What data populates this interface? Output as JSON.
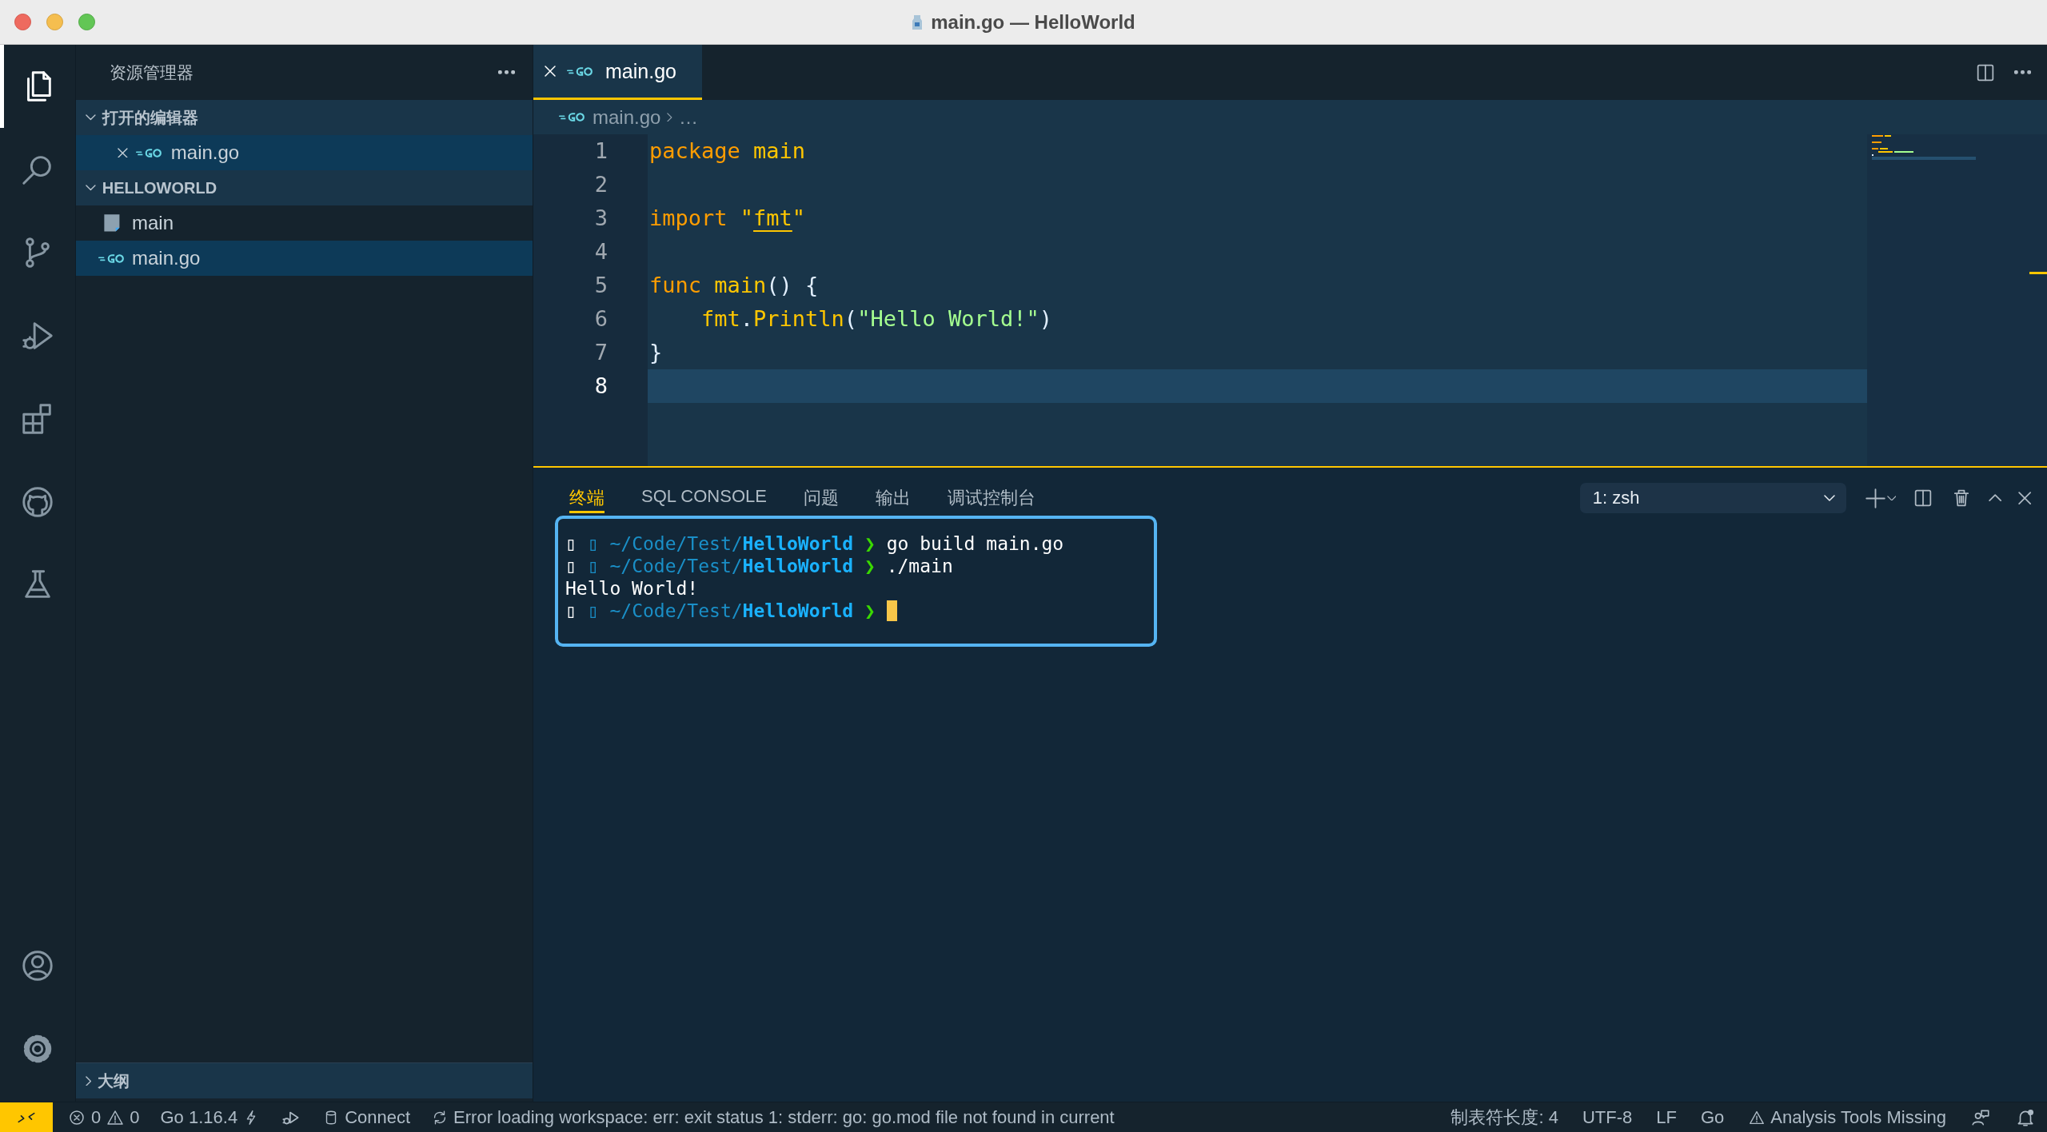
{
  "window": {
    "title": "main.go — HelloWorld"
  },
  "activity_bar": {
    "items": [
      {
        "kind": "files",
        "selected": true
      },
      {
        "kind": "search",
        "selected": false
      },
      {
        "kind": "source-control",
        "selected": false
      },
      {
        "kind": "run-debug",
        "selected": false
      },
      {
        "kind": "extensions",
        "selected": false
      },
      {
        "kind": "github",
        "selected": false
      },
      {
        "kind": "flask",
        "selected": false
      }
    ],
    "bottom": [
      {
        "kind": "account"
      },
      {
        "kind": "settings"
      }
    ]
  },
  "sidebar": {
    "title": "资源管理器",
    "sections": [
      {
        "kind": "open-editors",
        "label": "打开的编辑器",
        "expanded": true,
        "items": [
          {
            "name": "main.go",
            "kind": "go",
            "selected": true
          }
        ]
      },
      {
        "kind": "folder",
        "label": "HELLOWORLD",
        "expanded": true,
        "items": [
          {
            "name": "main",
            "kind": "file",
            "selected": false
          },
          {
            "name": "main.go",
            "kind": "go",
            "selected": true
          }
        ]
      }
    ],
    "outline": {
      "label": "大纲",
      "expanded": false
    }
  },
  "editor": {
    "tabs": [
      {
        "label": "main.go",
        "kind": "go",
        "selected": true
      }
    ],
    "breadcrumb": {
      "file": "main.go",
      "more": "…"
    },
    "lines": [
      {
        "number": "1",
        "current": false,
        "tokens": [
          {
            "kind": "keyword",
            "text": "package "
          },
          {
            "kind": "name",
            "text": "main"
          }
        ]
      },
      {
        "number": "2",
        "current": false
      },
      {
        "number": "3",
        "current": false,
        "tokens": [
          {
            "kind": "keyword",
            "text": "import "
          },
          {
            "kind": "quote",
            "text": "\""
          },
          {
            "kind": "module",
            "text": "fmt"
          },
          {
            "kind": "quote",
            "text": "\""
          }
        ]
      },
      {
        "number": "4",
        "current": false
      },
      {
        "number": "5",
        "current": false,
        "tokens": [
          {
            "kind": "keyword",
            "text": "func "
          },
          {
            "kind": "name",
            "text": "main"
          },
          {
            "kind": "plain",
            "text": "() {"
          }
        ]
      },
      {
        "number": "6",
        "current": false,
        "tokens": [
          {
            "kind": "name",
            "text": "    fmt"
          },
          {
            "kind": "plain",
            "text": "."
          },
          {
            "kind": "name",
            "text": "Println"
          },
          {
            "kind": "plain",
            "text": "("
          },
          {
            "kind": "string",
            "text": "\"Hello World!\""
          },
          {
            "kind": "plain",
            "text": ")"
          }
        ]
      },
      {
        "number": "7",
        "current": false,
        "tokens": [
          {
            "kind": "plain",
            "text": "}"
          }
        ]
      },
      {
        "number": "8",
        "current": true
      }
    ]
  },
  "panel": {
    "tabs": [
      {
        "label": "终端",
        "selected": true
      },
      {
        "label": "SQL CONSOLE",
        "selected": false
      },
      {
        "label": "问题",
        "selected": false
      },
      {
        "label": "输出",
        "selected": false
      },
      {
        "label": "调试控制台",
        "selected": false
      }
    ],
    "terminal_select": {
      "value": "1: zsh"
    },
    "terminal": {
      "lines": [
        {
          "kind": "prompt",
          "glyph_a": "▯",
          "glyph_b": "▯",
          "path": "~/Code/Test/",
          "dir": "HelloWorld",
          "arrow": "❯",
          "command": "go build main.go",
          "cursor": false
        },
        {
          "kind": "prompt",
          "glyph_a": "▯",
          "glyph_b": "▯",
          "path": "~/Code/Test/",
          "dir": "HelloWorld",
          "arrow": "❯",
          "command": "./main",
          "cursor": false
        },
        {
          "kind": "output",
          "text": "Hello World!"
        },
        {
          "kind": "prompt",
          "glyph_a": "▯",
          "glyph_b": "▯",
          "path": "~/Code/Test/",
          "dir": "HelloWorld",
          "arrow": "❯",
          "cursor": true
        }
      ]
    }
  },
  "status_bar": {
    "left": [
      {
        "kind": "remote"
      },
      {
        "kind": "problems",
        "errors": "0",
        "warnings": "0"
      },
      {
        "kind": "version",
        "text": "Go 1.16.4"
      },
      {
        "kind": "debug"
      },
      {
        "kind": "connect",
        "text": "Connect"
      },
      {
        "kind": "sync",
        "text": "Error loading workspace: err: exit status 1: stderr: go: go.mod file not found in current"
      }
    ],
    "right": [
      {
        "kind": "plain",
        "text": "制表符长度: 4"
      },
      {
        "kind": "plain",
        "text": "UTF-8"
      },
      {
        "kind": "plain",
        "text": "LF"
      },
      {
        "kind": "plain",
        "text": "Go"
      },
      {
        "kind": "warning",
        "text": "Analysis Tools Missing"
      },
      {
        "kind": "feedback"
      },
      {
        "kind": "bell"
      }
    ]
  }
}
